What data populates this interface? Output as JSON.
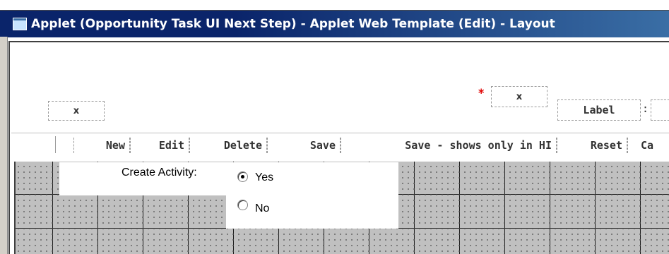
{
  "window": {
    "title": "Applet (Opportunity Task UI Next Step) - Applet Web Template (Edit) - Layout"
  },
  "placeholders": {
    "left_x": "x",
    "right_x": "x",
    "label": "Label"
  },
  "toolbar": {
    "buttons": [
      "New",
      "Edit",
      "Delete",
      "Save",
      "Save - shows only in HI",
      "Reset",
      "Ca"
    ]
  },
  "form": {
    "field_label": "Create Activity:",
    "options": [
      {
        "label": "Yes",
        "checked": true
      },
      {
        "label": "No",
        "checked": false
      }
    ]
  },
  "colors": {
    "title_bar": "#0a246a",
    "required_star": "#e00000",
    "grid_bg": "#c0c0c0"
  }
}
